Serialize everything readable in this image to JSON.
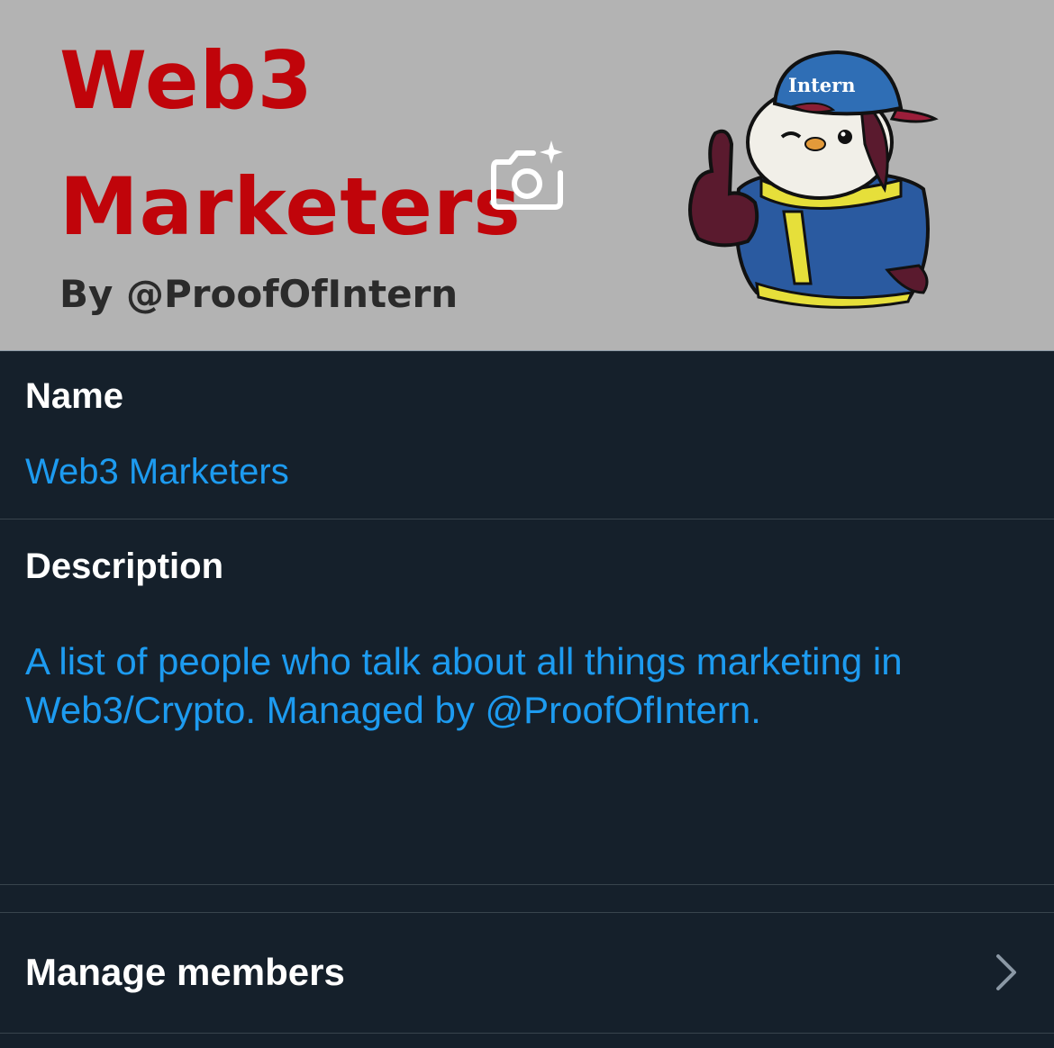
{
  "banner": {
    "title_line1": "Web3",
    "title_line2": "Marketers",
    "byline": "By @ProofOfIntern",
    "mascot_cap_text": "Intern",
    "edit_photo_icon": "camera-plus-icon"
  },
  "name_section": {
    "label": "Name",
    "value": "Web3 Marketers"
  },
  "description_section": {
    "label": "Description",
    "value": "A list of people who talk about all things marketing in Web3/Crypto. Managed by @ProofOfIntern."
  },
  "manage_members": {
    "label": "Manage members",
    "icon": "chevron-right-icon"
  },
  "colors": {
    "background": "#15202b",
    "accent": "#1d9bf0",
    "divider": "#38444d",
    "banner_bg": "#b3b3b3",
    "banner_title": "#c0040a"
  }
}
